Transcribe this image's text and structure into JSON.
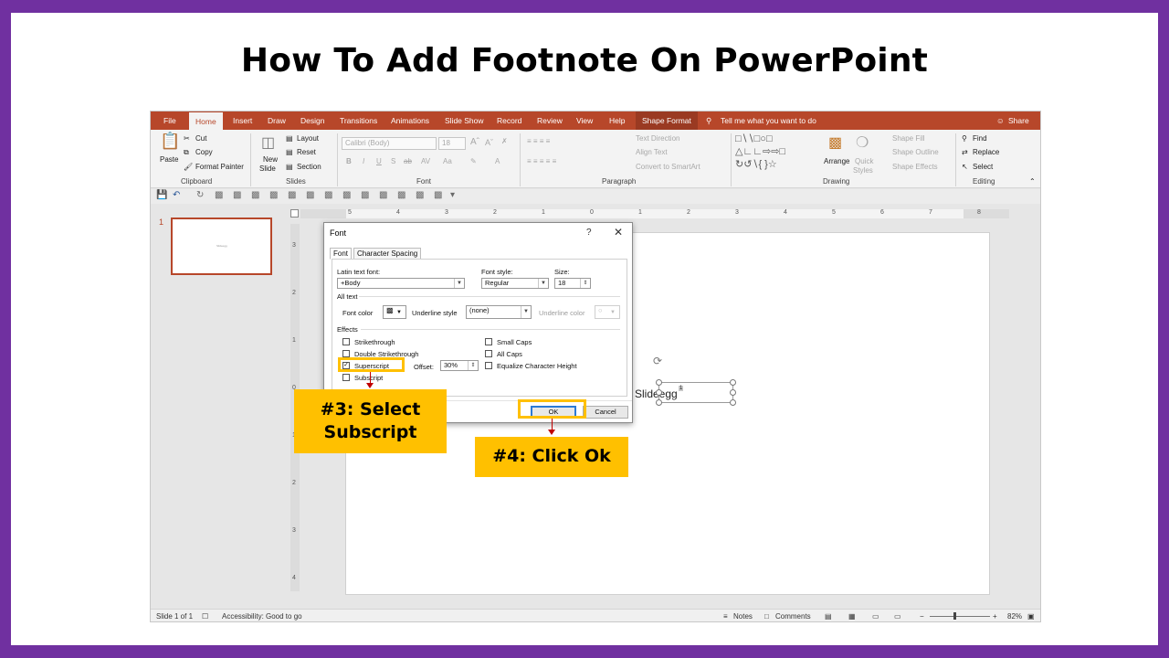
{
  "page": {
    "title": "How To Add Footnote On PowerPoint"
  },
  "tabs": [
    {
      "label": "File"
    },
    {
      "label": "Home"
    },
    {
      "label": "Insert"
    },
    {
      "label": "Draw"
    },
    {
      "label": "Design"
    },
    {
      "label": "Transitions"
    },
    {
      "label": "Animations"
    },
    {
      "label": "Slide Show"
    },
    {
      "label": "Record"
    },
    {
      "label": "Review"
    },
    {
      "label": "View"
    },
    {
      "label": "Help"
    },
    {
      "label": "Shape Format"
    }
  ],
  "tell_me": "Tell me what you want to do",
  "share": "Share",
  "ribbon": {
    "clipboard": {
      "paste": "Paste",
      "cut": "Cut",
      "copy": "Copy",
      "format_painter": "Format Painter",
      "label": "Clipboard"
    },
    "slides": {
      "new_slide": "New",
      "new_slide2": "Slide",
      "layout": "Layout",
      "reset": "Reset",
      "section": "Section",
      "label": "Slides"
    },
    "font": {
      "font_name": "Calibri (Body)",
      "font_size": "18",
      "label": "Font"
    },
    "paragraph": {
      "text_direction": "Text Direction",
      "align_text": "Align Text",
      "convert_smartart": "Convert to SmartArt",
      "label": "Paragraph"
    },
    "drawing": {
      "arrange": "Arrange",
      "quick_styles": "Quick",
      "quick_styles2": "Styles",
      "shape_fill": "Shape Fill",
      "shape_outline": "Shape Outline",
      "shape_effects": "Shape Effects",
      "label": "Drawing"
    },
    "editing": {
      "find": "Find",
      "replace": "Replace",
      "select": "Select",
      "label": "Editing"
    }
  },
  "thumbnail": {
    "number": "1",
    "text": "Slideegg"
  },
  "ruler_h": [
    "5",
    "4",
    "3",
    "2",
    "1",
    "0",
    "1",
    "2",
    "3",
    "4",
    "5",
    "6",
    "7",
    "8"
  ],
  "ruler_v": [
    "3",
    "2",
    "1",
    "0",
    "1",
    "2",
    "3",
    "4"
  ],
  "textbox": {
    "text": "Slideegg",
    "superscript": "1"
  },
  "status": {
    "slide": "Slide 1 of 1",
    "accessibility": "Accessibility: Good to go",
    "notes": "Notes",
    "comments": "Comments",
    "zoom": "82%"
  },
  "dialog": {
    "title": "Font",
    "help": "?",
    "close": "✕",
    "tab_font": "Font",
    "tab_spacing": "Character Spacing",
    "latin_label": "Latin text font:",
    "latin_value": "+Body",
    "style_label": "Font style:",
    "style_value": "Regular",
    "size_label": "Size:",
    "size_value": "18",
    "all_text": "All text",
    "font_color": "Font color",
    "underline_style": "Underline style",
    "underline_value": "(none)",
    "underline_color": "Underline color",
    "effects": "Effects",
    "strikethrough": "Strikethrough",
    "double_strikethrough": "Double Strikethrough",
    "superscript": "Superscript",
    "subscript": "Subscript",
    "offset_label": "Offset:",
    "offset_value": "30%",
    "small_caps": "Small Caps",
    "all_caps": "All Caps",
    "equalize": "Equalize Character Height",
    "ok": "OK",
    "cancel": "Cancel"
  },
  "callouts": {
    "step3_line1": "#3: Select",
    "step3_line2": "Subscript",
    "step4": "#4: Click Ok"
  },
  "colors": {
    "accent": "#b7472a",
    "highlight": "#ffc000",
    "frame": "#7030a0",
    "arrow": "#c00000"
  }
}
